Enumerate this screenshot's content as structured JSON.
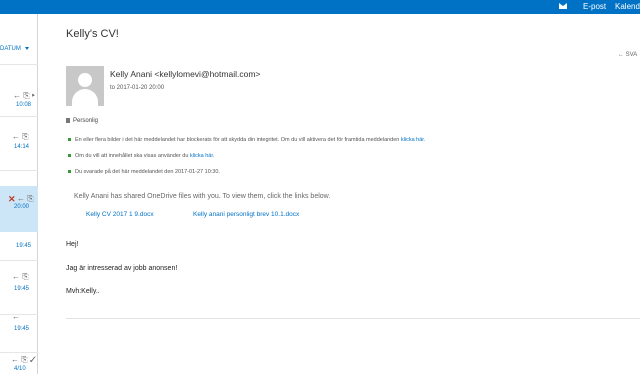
{
  "topbar": {
    "nav_epost": "E-post",
    "nav_kalender": "Kalend"
  },
  "list": {
    "sort_label": "DATUM",
    "items": [
      {
        "time": "10:08",
        "icons": "←  ⎘  ▸"
      },
      {
        "time": "14:14",
        "icons": "←  ⎘"
      },
      {
        "time": "20:00",
        "icons": "←  ⎘",
        "selected": true
      },
      {
        "time": "19:45",
        "icons": ""
      },
      {
        "time": "19:45",
        "icons": "←  ⎘"
      },
      {
        "time": "19:45",
        "icons": "←"
      },
      {
        "time": "4/10",
        "icons": "←  ⎘  ✓"
      }
    ]
  },
  "message": {
    "subject": "Kelly's CV!",
    "reply_all": "← SVA",
    "sender": "Kelly Anani <kellylomevi@hotmail.com>",
    "to_line": "to 2017-01-20 20:00",
    "flag_label": "Personlig",
    "notices": [
      {
        "text": "En eller flera bilder i det här meddelandet har blockerats för att skydda din integritet. Om du vill aktivera det för framtida meddelanden ",
        "link": "klicka här."
      },
      {
        "text": "Om du vill att innehållet ska visas använder du ",
        "link": "klicka här."
      },
      {
        "text": "Du svarade på det här meddelandet den 2017-01-27 10:30.",
        "link": ""
      }
    ],
    "onedrive_line": "Kelly Anani has shared OneDrive files with you. To view them, click the links below.",
    "attachments": [
      "Kelly CV 2017 1 9.docx",
      "Kelly anani personligt brev 10.1.docx"
    ],
    "body": [
      "Hej!",
      "Jag är intresserad av jobb anonsen!",
      "Mvh:Kelly.."
    ]
  },
  "colors": {
    "accent": "#0072c6",
    "selected_row": "#cde6f7",
    "avatar_bg": "#c8c8c8"
  }
}
